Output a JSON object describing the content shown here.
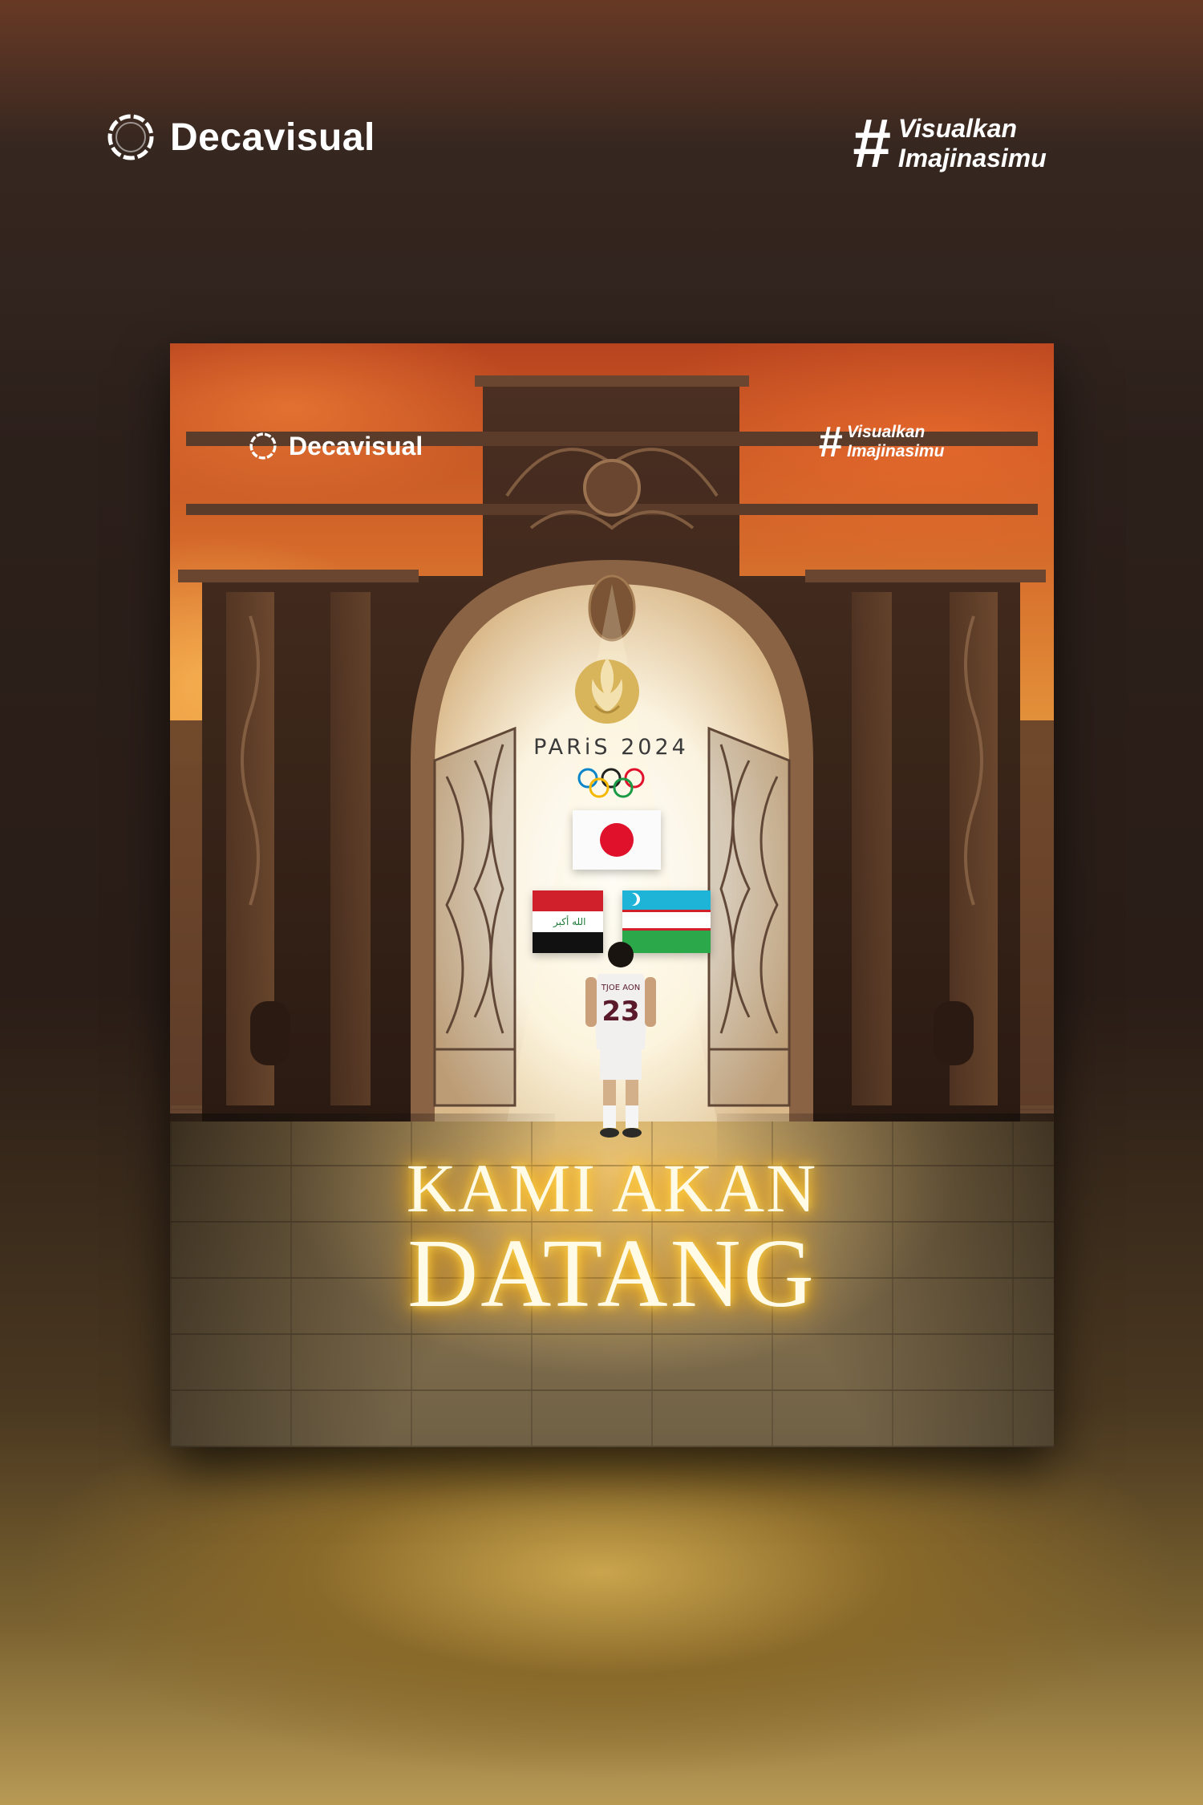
{
  "outer": {
    "brand_name": "Decavisual",
    "hashtag_symbol": "#",
    "hashtag_line1": "Visualkan",
    "hashtag_line2": "Imajinasimu"
  },
  "poster": {
    "brand_name": "Decavisual",
    "hashtag_symbol": "#",
    "hashtag_line1": "Visualkan",
    "hashtag_line2": "Imajinasimu",
    "olympics_text": "PARiS 2024",
    "player_name": "TJOE AON",
    "player_number": "23",
    "headline_line1": "KAMI AKAN",
    "headline_line2": "DATANG",
    "flags": [
      "japan-flag",
      "iraq-flag",
      "uzbekistan-flag"
    ]
  },
  "colors": {
    "sky_top": "#b8441f",
    "sky_glow": "#e69a3d",
    "headline_glow": "#ffb300",
    "japan_red": "#e0112b",
    "olympic_gold": "#d8b45a"
  }
}
